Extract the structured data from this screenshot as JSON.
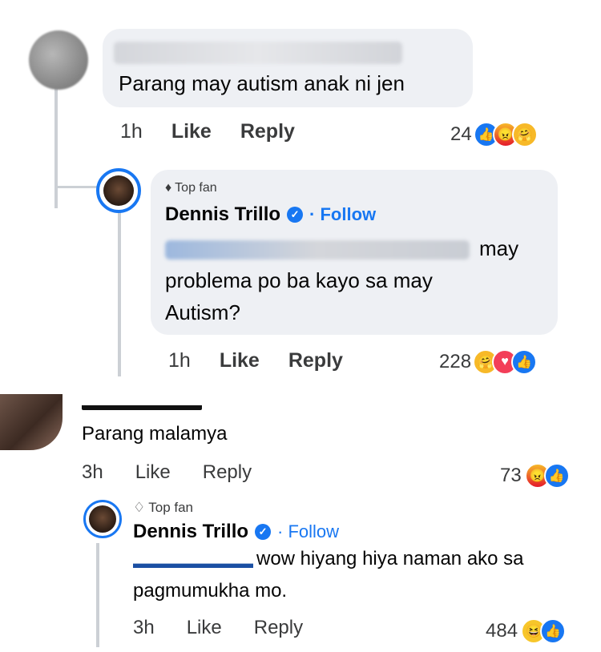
{
  "thread1": {
    "comment": {
      "text": "Parang may autism anak ni jen",
      "time": "1h",
      "like": "Like",
      "reply": "Reply",
      "reaction_count": "24",
      "reactions": [
        "like-icon",
        "angry-icon",
        "care-icon"
      ]
    },
    "reply": {
      "badge": "Top fan",
      "name": "Dennis Trillo",
      "follow": "· Follow",
      "text_line1_tail": "may",
      "text_line2": "problema po ba kayo sa may",
      "text_line3": "Autism?",
      "time": "1h",
      "like": "Like",
      "reply": "Reply",
      "reaction_count": "228",
      "reactions": [
        "care-icon",
        "heart-icon",
        "like-icon"
      ]
    }
  },
  "thread2": {
    "comment": {
      "text": "Parang malamya",
      "time": "3h",
      "like": "Like",
      "reply": "Reply",
      "reaction_count": "73",
      "reactions": [
        "angry-icon",
        "like-icon"
      ]
    },
    "reply": {
      "badge": "Top fan",
      "name": "Dennis Trillo",
      "follow": "· Follow",
      "text_tail": "wow hiyang hiya naman ako sa",
      "text_line2": "pagmumukha mo.",
      "time": "3h",
      "like": "Like",
      "reply": "Reply",
      "reaction_count": "484",
      "reactions": [
        "haha-icon",
        "like-icon"
      ]
    }
  }
}
